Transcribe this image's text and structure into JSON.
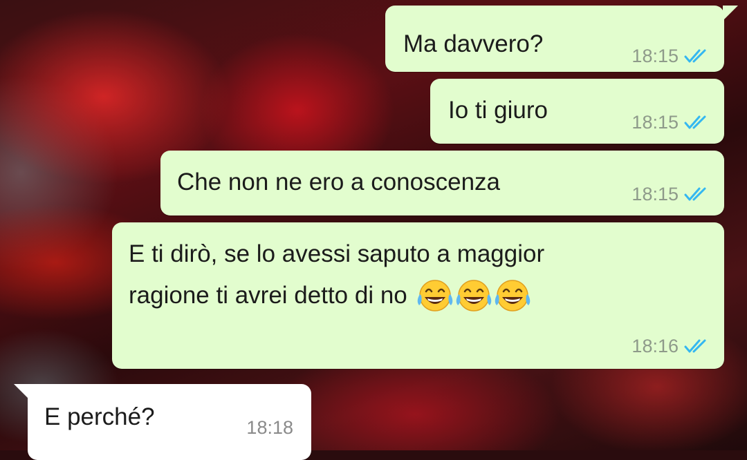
{
  "messages": [
    {
      "direction": "out",
      "text": "Ma davvero?",
      "time": "18:15",
      "status": "read-double-check-icon"
    },
    {
      "direction": "out",
      "text": "Io ti giuro",
      "time": "18:15",
      "status": "read-double-check-icon"
    },
    {
      "direction": "out",
      "text": "Che non ne ero a conoscenza",
      "time": "18:15",
      "status": "read-double-check-icon"
    },
    {
      "direction": "out",
      "line1": "E ti dirò, se lo avessi saputo a maggior",
      "line2": "ragione ti avrei detto di no",
      "emoji": [
        "face-with-tears-of-joy-icon",
        "face-with-tears-of-joy-icon",
        "face-with-tears-of-joy-icon"
      ],
      "time": "18:16",
      "status": "read-double-check-icon"
    },
    {
      "direction": "in",
      "text": "E perché?",
      "time": "18:18"
    }
  ],
  "colors": {
    "outgoing_bubble": "#e2fdce",
    "incoming_bubble": "#ffffff",
    "read_ticks": "#34b7f1",
    "timestamp": "#8e9a8a"
  }
}
